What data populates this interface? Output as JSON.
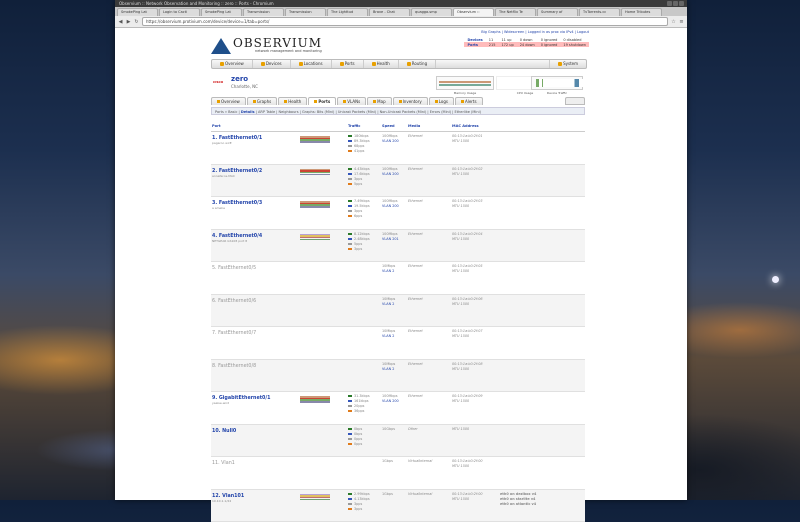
{
  "window": {
    "title": "Observium :: Network Observation and Monitoring :: zero :: Ports - Chromium"
  },
  "tabs": [
    "SmokePing Lat",
    "Login to Cacti",
    "SmokePing Lat",
    "Transmission",
    "Transmission",
    "The Lighttud",
    "Brave - Chat",
    "quagga-smp",
    "Observium ::",
    "The Netflix Te",
    "Summary of",
    "TvTorrents.cc",
    "Home Tributes"
  ],
  "active_tab": "Observium ::",
  "address": "https://observium.protivium.com/device/device=1/tab=ports/",
  "logo": {
    "title": "OBSERVIUM",
    "subtitle": "network management and monitoring"
  },
  "header": {
    "links": "Big Graphs | Widescreen | Logged in as prox via IPv4 | Logout"
  },
  "stats": [
    {
      "label": "Devices",
      "total": "11",
      "up": "11 up",
      "down": "0 down",
      "ignored": "0 ignored",
      "disabled": "0 disabled"
    },
    {
      "label": "Ports",
      "total": "215",
      "up": "172 up",
      "down": "24 down",
      "ignored": "0 ignored",
      "disabled": "19 shutdown"
    }
  ],
  "menu": [
    "Overview",
    "Devices",
    "Locations",
    "Ports",
    "Health",
    "Routing"
  ],
  "menu_system": "System",
  "device": {
    "vendor": "CISCO",
    "name": "zero",
    "location": "Charlotte, NC"
  },
  "mini_graphs": [
    "Memory Usage",
    "CPU Usage",
    "Device Traffic"
  ],
  "device_tabs": [
    "Overview",
    "Graphs",
    "Health",
    "Ports",
    "VLANs",
    "Map",
    "Inventory",
    "Logs",
    "Alerts"
  ],
  "subnav": {
    "prefix": "Ports » Basic |",
    "details": "Details",
    "rest": "| ARP Table | Neighbours | Graphs: Bits (Mini) | Unicast Packets (Mini) | Non-Unicast Packets (Mini) | Errors (Mini) | Etherlike (Mini)"
  },
  "columns": [
    "Port",
    "Traffic",
    "Speed",
    "Media",
    "MAC Address"
  ],
  "colors": {
    "in": "#2a7a2a",
    "out": "#3355bb",
    "pin": "#999999",
    "pout": "#e07b1a",
    "link": "#2244aa"
  },
  "ports": [
    {
      "name": "1. FastEthernet0/1",
      "desc": "pagaroo wirE",
      "traffic": [
        "180kbps",
        "89.3kbps",
        "68pps",
        "41pps"
      ],
      "speed": "100Mbps",
      "vlan": "VLAN 200",
      "media": "Ethernet",
      "mac": "00:13:1a:b0:2f:01",
      "mtu": "MTU 1500",
      "vlans": [],
      "enabled": true,
      "graph": true
    },
    {
      "name": "2. FastEthernet0/2",
      "desc": "annafer-le-MAC",
      "traffic": [
        "4.43kbps",
        "17.6kbps",
        "3pps",
        "5pps"
      ],
      "speed": "100Mbps",
      "vlan": "VLAN 200",
      "media": "Ethernet",
      "mac": "00:13:1a:b0:2f:02",
      "mtu": "MTU 1500",
      "vlans": [],
      "enabled": true,
      "graph": true
    },
    {
      "name": "3. FastEthernet0/3",
      "desc": "a amelie",
      "traffic": [
        "7.49kbps",
        "19.5kbps",
        "3pps",
        "6pps"
      ],
      "speed": "100Mbps",
      "vlan": "VLAN 200",
      "media": "Ethernet",
      "mac": "00:13:1a:b0:2f:03",
      "mtu": "MTU 1500",
      "vlans": [],
      "enabled": true,
      "graph": true
    },
    {
      "name": "4. FastEthernet0/4",
      "desc": "NETGEAR GS108 port 8",
      "traffic": [
        "8.12kbps",
        "2.48kbps",
        "5pps",
        "3pps"
      ],
      "speed": "100Mbps",
      "vlan": "VLAN 201",
      "media": "Ethernet",
      "mac": "00:13:1a:b0:2f:04",
      "mtu": "MTU 1500",
      "vlans": [],
      "enabled": true,
      "graph": true
    },
    {
      "name": "5. FastEthernet0/5",
      "desc": "",
      "traffic": [],
      "speed": "10Mbps",
      "vlan": "VLAN 2",
      "media": "Ethernet",
      "mac": "00:13:1a:b0:2f:05",
      "mtu": "MTU 1500",
      "vlans": [],
      "enabled": false,
      "graph": false
    },
    {
      "name": "6. FastEthernet0/6",
      "desc": "",
      "traffic": [],
      "speed": "10Mbps",
      "vlan": "VLAN 2",
      "media": "Ethernet",
      "mac": "00:13:1a:b0:2f:06",
      "mtu": "MTU 1500",
      "vlans": [],
      "enabled": false,
      "graph": false
    },
    {
      "name": "7. FastEthernet0/7",
      "desc": "",
      "traffic": [],
      "speed": "10Mbps",
      "vlan": "VLAN 2",
      "media": "Ethernet",
      "mac": "00:13:1a:b0:2f:07",
      "mtu": "MTU 1500",
      "vlans": [],
      "enabled": false,
      "graph": false
    },
    {
      "name": "8. FastEthernet0/8",
      "desc": "",
      "traffic": [],
      "speed": "10Mbps",
      "vlan": "VLAN 2",
      "media": "Ethernet",
      "mac": "00:13:1a:b0:2f:08",
      "mtu": "MTU 1500",
      "vlans": [],
      "enabled": false,
      "graph": false
    },
    {
      "name": "9. GigabitEthernet0/1",
      "desc": "yaalse-wird",
      "traffic": [
        "31.3kbps",
        "161kbps",
        "20pps",
        "36pps"
      ],
      "speed": "100Mbps",
      "vlan": "VLAN 200",
      "media": "Ethernet",
      "mac": "00:13:1a:b0:2f:09",
      "mtu": "MTU 1500",
      "vlans": [],
      "enabled": true,
      "graph": true
    },
    {
      "name": "10. Null0",
      "desc": "",
      "traffic": [
        "0bps",
        "0bps",
        "0pps",
        "0pps"
      ],
      "speed": "10Gbps",
      "vlan": "",
      "media": "Other",
      "mac": "",
      "mtu": "MTU 1500",
      "vlans": [],
      "enabled": true,
      "graph": false
    },
    {
      "name": "11. Vlan1",
      "desc": "",
      "traffic": [],
      "speed": "1Gbps",
      "vlan": "",
      "media": "VirtualInternal",
      "mac": "00:13:1a:b0:2f:00",
      "mtu": "MTU 1500",
      "vlans": [],
      "enabled": false,
      "graph": false
    },
    {
      "name": "12. Vlan101",
      "desc": "10.10.1.1/24",
      "traffic": [
        "2.99kbps",
        "4.13kbps",
        "3pps",
        "3pps"
      ],
      "speed": "1Gbps",
      "vlan": "",
      "media": "VirtualInternal",
      "mac": "00:13:1a:b0:2f:00",
      "mtu": "MTU 1500",
      "vlans": [
        "eth0 on dezibox v4",
        "eth0 on starlite v4",
        "eth0 on atlantic v4"
      ],
      "enabled": true,
      "graph": true
    }
  ]
}
